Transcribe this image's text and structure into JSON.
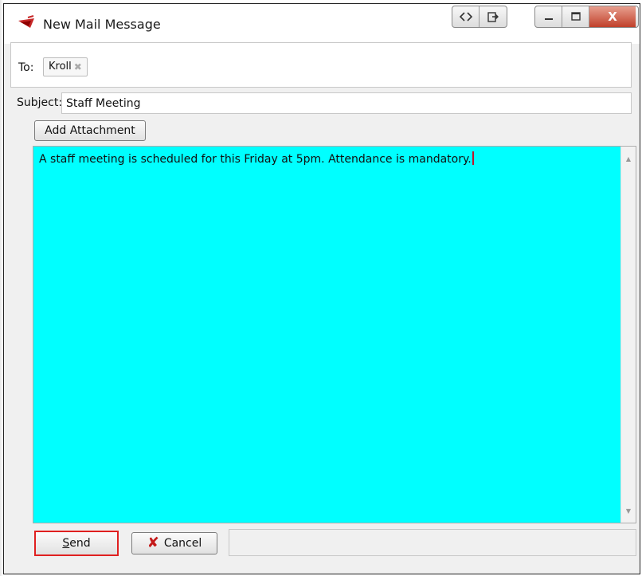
{
  "window": {
    "title": "New Mail Message",
    "controls": {
      "restore_icon": "sync-icon",
      "popout_icon": "popout-icon",
      "minimize_icon": "minimize-icon",
      "maximize_icon": "maximize-icon",
      "close_label": "X"
    }
  },
  "to": {
    "label": "To:",
    "recipients": [
      {
        "name": "Kroll",
        "remove_symbol": "✖"
      }
    ]
  },
  "subject": {
    "label": "Subject:",
    "value": "Staff Meeting"
  },
  "attachment": {
    "button_label": "Add Attachment"
  },
  "message": {
    "body": "A staff meeting is scheduled for this Friday at 5pm. Attendance is mandatory.",
    "background_color": "#00ffff"
  },
  "footer": {
    "send_label": "Send",
    "send_mnemonic": "S",
    "send_rest": "end",
    "cancel_label": "Cancel",
    "highlight_color": "#e02020"
  }
}
